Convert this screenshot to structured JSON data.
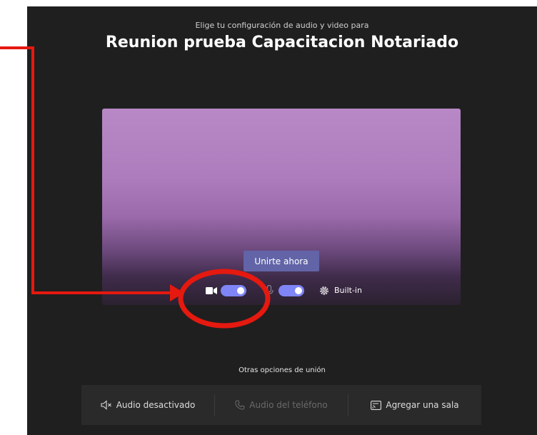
{
  "header": {
    "subtitle": "Elige tu configuración de audio y video para",
    "title": "Reunion prueba Capacitacion Notariado"
  },
  "preview": {
    "join_label": "Unirte ahora",
    "video_on": true,
    "audio_on": true,
    "device_label": "Built-in"
  },
  "options": {
    "heading": "Otras opciones de unión",
    "items": [
      {
        "label": "Audio desactivado",
        "icon": "speaker-off-icon",
        "enabled": true
      },
      {
        "label": "Audio del teléfono",
        "icon": "phone-icon",
        "enabled": false
      },
      {
        "label": "Agregar una sala",
        "icon": "cast-icon",
        "enabled": true
      }
    ]
  },
  "colors": {
    "background": "#201f1f",
    "accent": "#6264a7",
    "toggle_on": "#7f85f5",
    "annotation": "#e5190f"
  }
}
